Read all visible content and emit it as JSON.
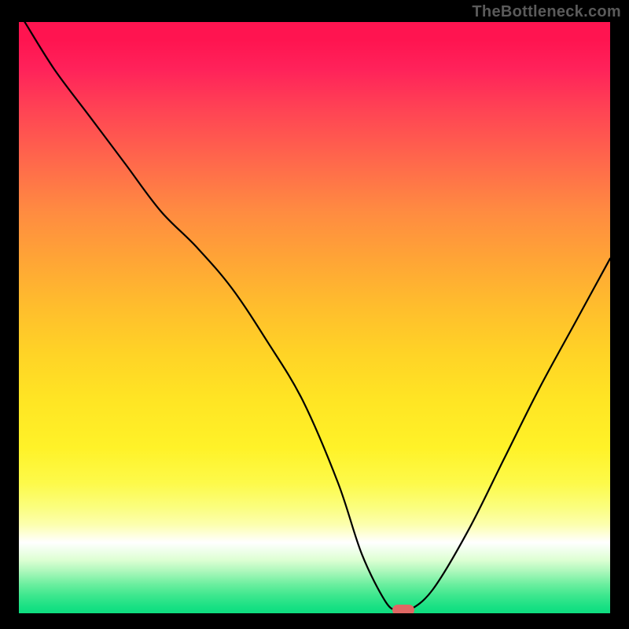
{
  "watermark": "TheBottleneck.com",
  "chart_data": {
    "type": "line",
    "title": "",
    "xlabel": "",
    "ylabel": "",
    "xlim": [
      0,
      100
    ],
    "ylim": [
      0,
      100
    ],
    "grid": false,
    "legend": false,
    "series": [
      {
        "name": "bottleneck-curve",
        "x": [
          1,
          6,
          12,
          18,
          24,
          30,
          36,
          42,
          48,
          54,
          58,
          62,
          64,
          66,
          70,
          76,
          82,
          88,
          94,
          100
        ],
        "y": [
          100,
          92,
          84,
          76,
          68,
          62,
          55,
          46,
          36,
          22,
          10,
          2,
          0.5,
          0.5,
          4,
          14,
          26,
          38,
          49,
          60
        ]
      }
    ],
    "optimum_marker": {
      "x": 65,
      "y": 0.5
    },
    "background_gradient": {
      "top": "#ff1450",
      "mid": "#ffd326",
      "bottom": "#0edd80"
    }
  }
}
